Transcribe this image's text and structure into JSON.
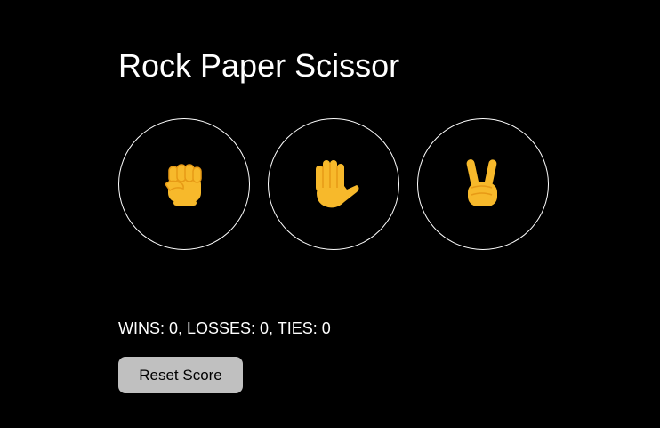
{
  "title": "Rock Paper Scissor",
  "choices": [
    {
      "id": "rock",
      "icon": "raised-fist-icon"
    },
    {
      "id": "paper",
      "icon": "raised-hand-icon"
    },
    {
      "id": "scissors",
      "icon": "victory-hand-icon"
    }
  ],
  "colors": {
    "background": "#000000",
    "text": "#ffffff",
    "circle_border": "#ffffff",
    "hand": "#f7b92b",
    "hand_shade": "#e79a16",
    "reset_bg": "#c0c0c0",
    "reset_text": "#000000"
  },
  "score": {
    "wins": 0,
    "losses": 0,
    "ties": 0,
    "text": "WINS: 0, LOSSES: 0, TIES: 0"
  },
  "reset_label": "Reset Score"
}
